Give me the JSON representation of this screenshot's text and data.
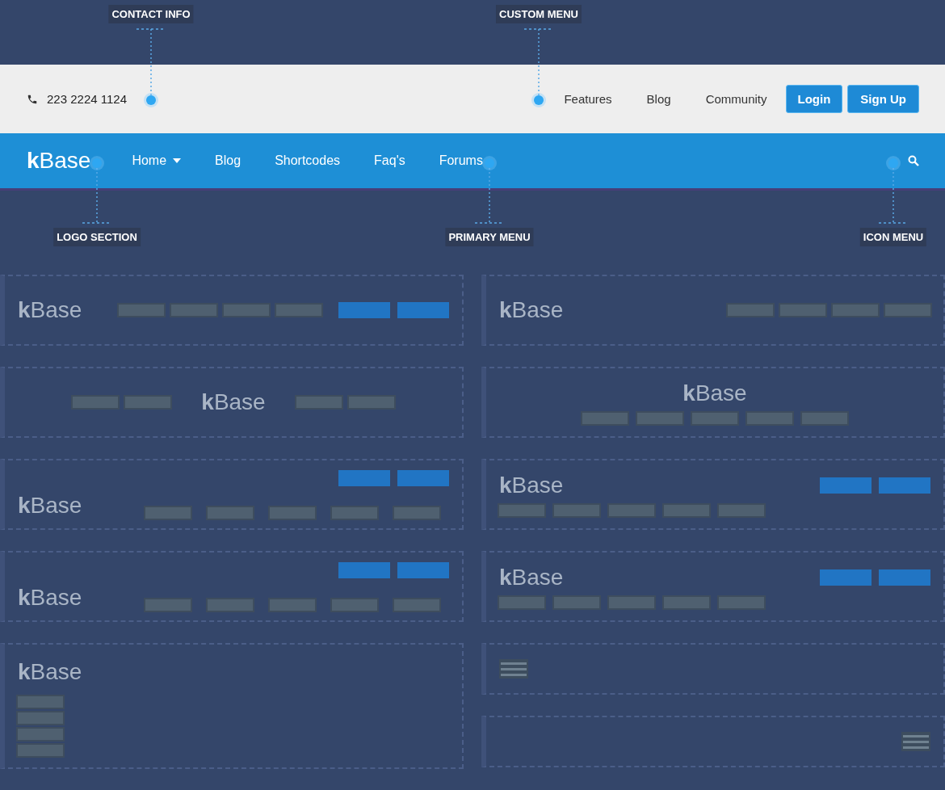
{
  "annotations": [
    {
      "label": "CONTACT INFO",
      "kind": "top"
    },
    {
      "label": "CUSTOM MENU",
      "kind": "top"
    },
    {
      "label": "LOGO SECTION",
      "kind": "bottom"
    },
    {
      "label": "PRIMARY MENU",
      "kind": "bottom"
    },
    {
      "label": "ICON MENU",
      "kind": "bottom"
    }
  ],
  "top_bar": {
    "phone": "223 2224 1124",
    "menu": [
      "Features",
      "Blog",
      "Community"
    ],
    "buttons": [
      {
        "label": "Login",
        "kind": "login"
      },
      {
        "label": "Sign Up",
        "kind": "signup"
      }
    ]
  },
  "header": {
    "logo": "**k**Base",
    "menu": [
      {
        "label": "Home",
        "dropdown": true
      },
      {
        "label": "Blog",
        "dropdown": false
      },
      {
        "label": "Shortcodes",
        "dropdown": false
      },
      {
        "label": "Faq's",
        "dropdown": false
      },
      {
        "label": "Forums",
        "dropdown": false
      }
    ]
  },
  "layouts": [
    {
      "cards": [
        {
          "kind": "logo-menu-buttons",
          "logo": "**k**Base"
        },
        {
          "kind": "split-menu-logo",
          "logo": "**k**Base"
        },
        {
          "kind": "buttons-over-menu",
          "logo": "**k**Base"
        },
        {
          "kind": "buttons-over-menu",
          "logo": "**k**Base"
        },
        {
          "kind": "vertical-menu",
          "logo": "**k**Base"
        }
      ]
    },
    {
      "cards": [
        {
          "kind": "logo-menu",
          "logo": "**k**Base"
        },
        {
          "kind": "centered-logo-menu",
          "logo": "**k**Base"
        },
        {
          "kind": "logo-buttons-menu",
          "logo": "**k**Base"
        },
        {
          "kind": "logo-buttons-menu",
          "logo": "**k**Base"
        },
        {
          "kind": "hamburger-left"
        },
        {
          "kind": "hamburger-right"
        }
      ]
    }
  ]
}
